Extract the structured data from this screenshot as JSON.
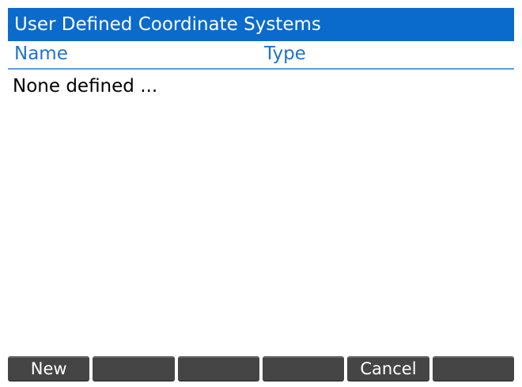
{
  "window": {
    "title": "User Defined Coordinate Systems"
  },
  "table": {
    "columns": [
      "Name",
      "Type"
    ],
    "empty_message": "None defined ..."
  },
  "softkeys": [
    "New",
    "",
    "",
    "",
    "Cancel",
    ""
  ],
  "colors": {
    "title_bar": "#0a6bcc",
    "header_text": "#1d73d3",
    "header_rule": "#5a9fe0",
    "softkey_bg": "#454545"
  }
}
